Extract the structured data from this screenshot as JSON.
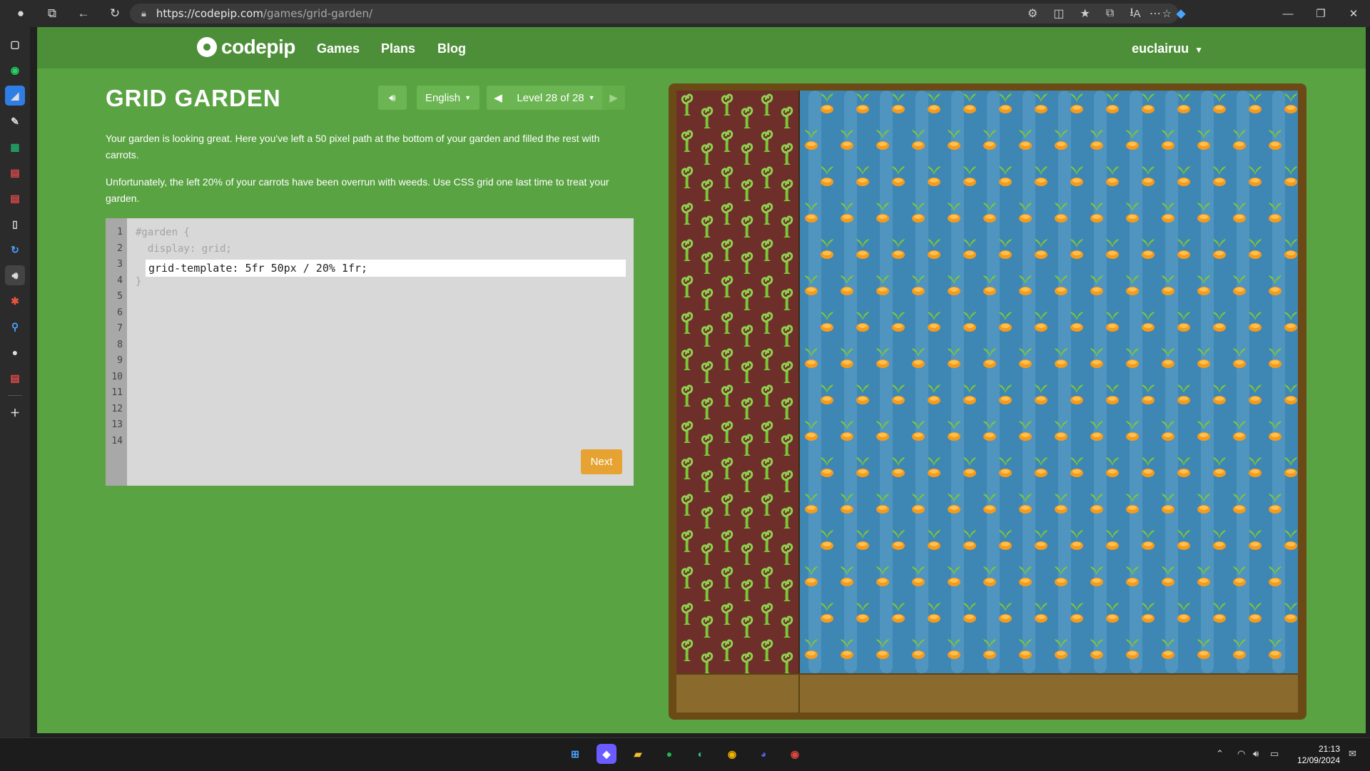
{
  "browser": {
    "url_host": "https://codepip.com",
    "url_path": "/games/grid-garden/",
    "window_controls": [
      "—",
      "❐",
      "✕"
    ]
  },
  "nav": {
    "logo": "codepip",
    "links": [
      "Games",
      "Plans",
      "Blog"
    ],
    "user": "euclairuu"
  },
  "game": {
    "title": "GRID GARDEN",
    "language": "English",
    "level": "Level 28 of 28",
    "paragraphs": [
      "Your garden is looking great. Here you've left a 50 pixel path at the bottom of your garden and filled the rest with carrots.",
      "Unfortunately, the left 20% of your carrots have been overrun with weeds. Use CSS grid one last time to treat your garden."
    ]
  },
  "editor": {
    "line_numbers": [
      "1",
      "2",
      "3",
      "4",
      "5",
      "6",
      "7",
      "8",
      "9",
      "10",
      "11",
      "12",
      "13",
      "14"
    ],
    "line1": "#garden {",
    "line2": "  display: grid;",
    "input_value": "grid-template: 5fr 50px / 20% 1fr;",
    "line4": "}",
    "next_label": "Next"
  },
  "taskbar": {
    "time": "21:13",
    "date": "12/09/2024"
  }
}
